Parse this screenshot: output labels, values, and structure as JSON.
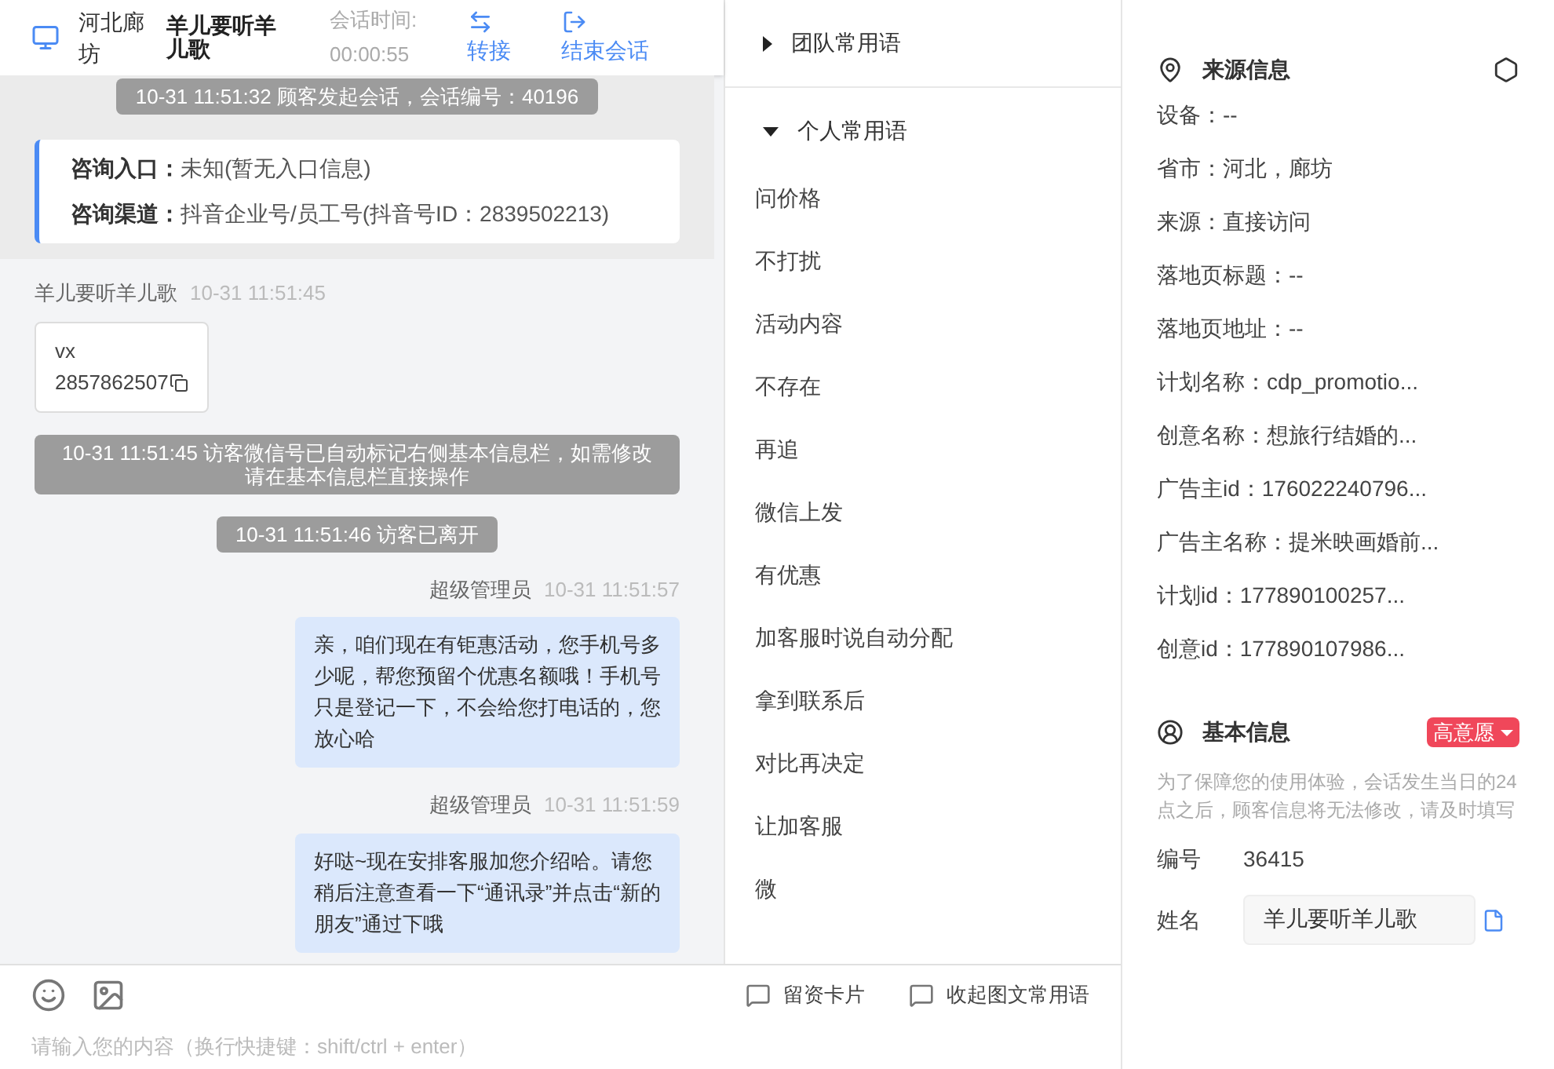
{
  "header": {
    "region": "河北廊坊",
    "customer": "羊儿要听羊儿歌",
    "timer_label": "会话时间:",
    "timer": "00:00:55",
    "actions": [
      {
        "kind": "transfer",
        "label": "转接"
      },
      {
        "kind": "end",
        "label": "结束会话"
      }
    ]
  },
  "messages": [
    {
      "kind": "system",
      "text": "10-31 11:51:32 顾客发起会话，会话编号：40196"
    },
    {
      "kind": "entry",
      "rows": [
        {
          "label": "咨询入口：",
          "value": "未知(暂无入口信息)"
        },
        {
          "label": "咨询渠道：",
          "value": "抖音企业号/员工号(抖音号ID：2839502213)"
        }
      ]
    },
    {
      "kind": "customer",
      "sender": "羊儿要听羊儿歌",
      "time": "10-31 11:51:45",
      "lines": [
        "vx",
        "2857862507"
      ]
    },
    {
      "kind": "system",
      "text": "10-31 11:51:45 访客微信号已自动标记右侧基本信息栏，如需修改请在基本信息栏直接操作"
    },
    {
      "kind": "system",
      "text": "10-31 11:51:46 访客已离开"
    },
    {
      "kind": "agent",
      "sender": "超级管理员",
      "time": "10-31 11:51:57",
      "text": "亲，咱们现在有钜惠活动，您手机号多少呢，帮您预留个优惠名额哦！手机号只是登记一下，不会给您打电话的，您放心哈"
    },
    {
      "kind": "agent",
      "sender": "超级管理员",
      "time": "10-31 11:51:59",
      "text": "好哒~现在安排客服加您介绍哈。请您稍后注意查看一下“通讯录”并点击“新的朋友”通过下哦"
    }
  ],
  "phrase_groups": [
    {
      "title": "团队常用语",
      "expanded": false
    },
    {
      "title": "个人常用语",
      "expanded": true,
      "items": [
        "问价格",
        "不打扰",
        "活动内容",
        "不存在",
        "再追",
        "微信上发",
        "有优惠",
        "加客服时说自动分配",
        "拿到联系后",
        "对比再决定",
        "让加客服",
        "微"
      ]
    }
  ],
  "composer": {
    "tools": [
      {
        "label": "留资卡片"
      },
      {
        "label": "收起图文常用语"
      }
    ],
    "placeholder": "请输入您的内容（换行快捷键：shift/ctrl + enter）"
  },
  "source_info": {
    "title": "来源信息",
    "rows": [
      "设备：--",
      "省市：河北，廊坊",
      "来源：直接访问",
      "落地页标题：--",
      "落地页地址：--",
      "计划名称：cdp_promotio...",
      "创意名称：想旅行结婚的...",
      "广告主id：176022240796...",
      "广告主名称：提米映画婚前...",
      "计划id：177890100257...",
      "创意id：177890107986..."
    ]
  },
  "basic_info": {
    "title": "基本信息",
    "tag": "高意愿",
    "note": "为了保障您的使用体验，会话发生当日的24点之后，顾客信息将无法修改，请及时填写",
    "fields": [
      {
        "kind": "text",
        "label": "编号",
        "value": "36415"
      },
      {
        "kind": "input",
        "label": "姓名",
        "value": "羊儿要听羊儿歌"
      }
    ]
  }
}
